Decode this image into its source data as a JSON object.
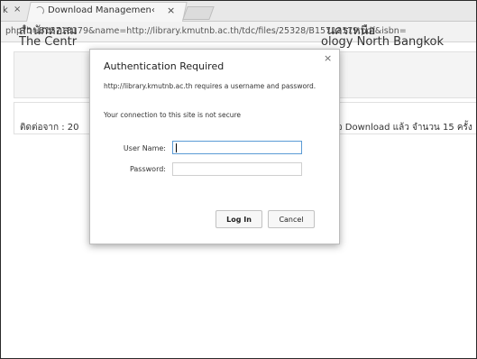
{
  "tabs": {
    "left_tab_fragment": "k",
    "left_tab_close": "×",
    "active_title": "Download Managemen‹",
    "active_close": "×"
  },
  "address_bar": {
    "url": "php?b=B15713179&name=http://library.kmutnb.ac.th/tdc/files/25328/B15713179.pdf&isbn="
  },
  "page": {
    "header_thai_left": "สำนักหอสม",
    "header_en_left": "The Centr",
    "header_thai_right": "นครเหนือ",
    "header_en_right": "ology North Bangkok",
    "contact_left": "ติดต่อจาก : 20",
    "contact_right": "นใจ Download แล้ว จำนวน 15 ครั้ง"
  },
  "dialog": {
    "title": "Authentication Required",
    "close": "×",
    "message": "http://library.kmutnb.ac.th requires a username and password.",
    "warning": "Your connection to this site is not secure",
    "username_label": "User Name:",
    "username_value": "",
    "password_label": "Password:",
    "password_value": "",
    "login_button": "Log In",
    "cancel_button": "Cancel"
  }
}
